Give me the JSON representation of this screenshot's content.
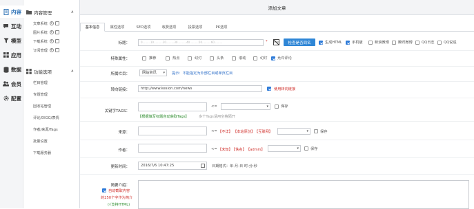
{
  "nav1": [
    {
      "label": "内容",
      "icon": "document-icon"
    },
    {
      "label": "互动",
      "icon": "chat-icon"
    },
    {
      "label": "模型",
      "icon": "funnel-icon"
    },
    {
      "label": "应用",
      "icon": "grid-icon"
    },
    {
      "label": "数据",
      "icon": "database-icon"
    },
    {
      "label": "会员",
      "icon": "users-icon"
    },
    {
      "label": "配置",
      "icon": "gear-icon"
    }
  ],
  "nav2": {
    "section1": "内容管理",
    "section1_items": [
      "文章系统",
      "图片系统",
      "下载系统",
      "订阅管理"
    ],
    "section2": "功能选项",
    "section2_items": [
      "栏目管理",
      "专题管理",
      "回收站管理",
      "评论/DIGG/表情",
      "作者/来源/Tags",
      "批量设置",
      "下载服务器"
    ],
    "plus": "+"
  },
  "title": "添加文章",
  "tabs": [
    "基本信息",
    "属性选项",
    "SEO选项",
    "收费选项",
    "投票选项",
    "PK选项"
  ],
  "form": {
    "title_label": "标题：",
    "title_star": "*",
    "title_ruler": "0.........10..........20.........30..........40..........50..........60.........",
    "check_same_button": "检查是否同名",
    "title_opts": [
      "生成HTML",
      "手机版",
      "新浪微博",
      "腾讯微博",
      "QQ日志",
      "QQ说说"
    ],
    "title_opts_checked": [
      true,
      true,
      false,
      false,
      false,
      false
    ],
    "attr_label": "特殊属性：",
    "attrs": [
      "推荐",
      "热点",
      "幻灯",
      "头条",
      "滚动",
      "幻灯",
      "允许评论"
    ],
    "attrs_checked": [
      false,
      false,
      false,
      false,
      false,
      false,
      true
    ],
    "column_label": "所属栏目：",
    "column_value": "网站资讯",
    "column_hint": "提示：不能指定为外部栏目或单页栏目",
    "redirect_label": "转向链接：",
    "redirect_value": "http://www.kesion.com/news",
    "redirect_check": "使用转向链接",
    "tags_label": "关键字TAGS：",
    "tags_or": "<=",
    "tags_save": "保存",
    "tags_auto": "【根据填写标题自动获取Tags】",
    "tags_hint": "多个Tags请用空格隔开",
    "source_label": "来源：",
    "source_or": "<=",
    "source_links": [
      "【不详】",
      "【本站原创】",
      "【互联网】"
    ],
    "source_save": "保存",
    "author_label": "作者：",
    "author_or": "<=",
    "author_links": [
      "【未知】",
      "【佚名】",
      "【admin】"
    ],
    "author_save": "保存",
    "time_label": "更新时间：",
    "time_value": "2016/7/6 10:47:25",
    "time_hint": "日期格式：年-月-日 时:分:秒",
    "intro_label": "简要介绍：",
    "intro_auto": "自动截取内容",
    "intro_auto2": "的250个字作为简介",
    "intro_html": "(√支持HTML)"
  }
}
